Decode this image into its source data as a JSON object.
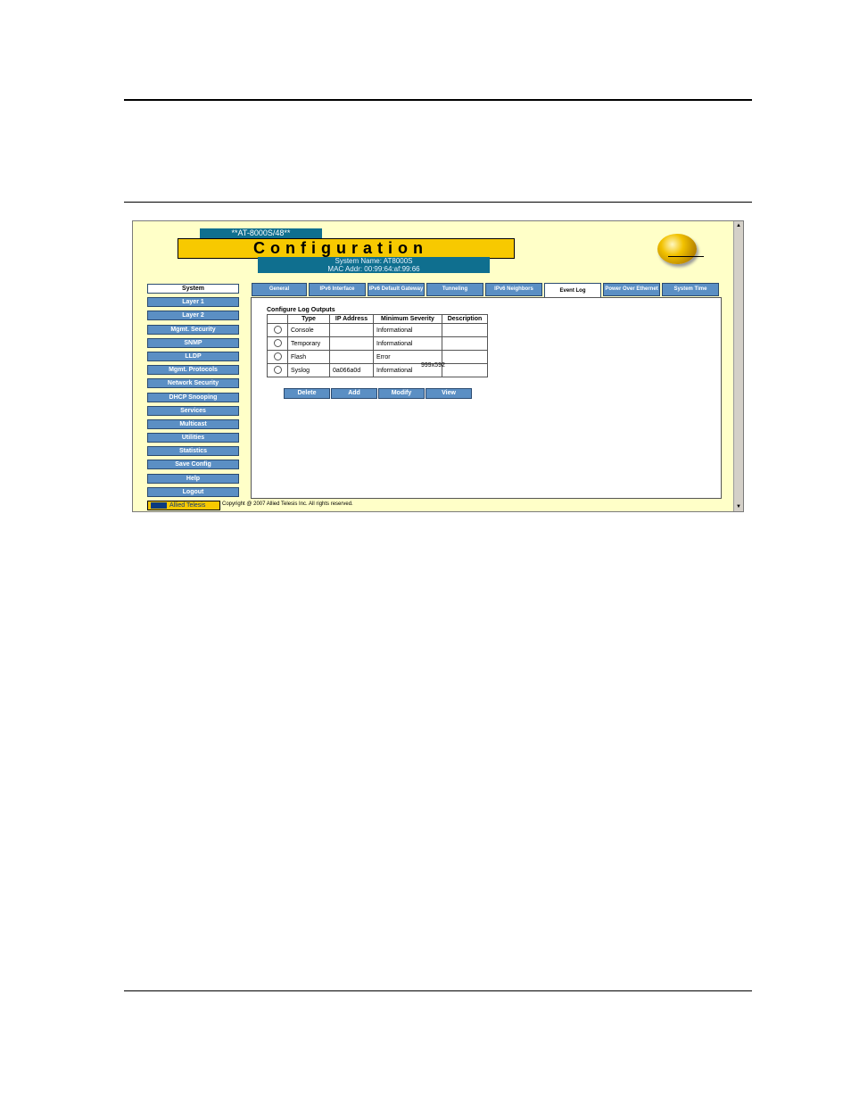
{
  "banner": {
    "device_name": "**AT-8000S/48**",
    "title": "Configuration",
    "system_name": "System Name: AT8000S",
    "mac_addr": "MAC Addr: 00:99:64:af:99:66"
  },
  "nav": {
    "items": [
      {
        "label": "System",
        "active": true
      },
      {
        "label": "Layer 1"
      },
      {
        "label": "Layer 2"
      },
      {
        "label": "Mgmt. Security"
      },
      {
        "label": "SNMP"
      },
      {
        "label": "LLDP"
      },
      {
        "label": "Mgmt. Protocols"
      },
      {
        "label": "Network Security"
      },
      {
        "label": "DHCP Snooping"
      },
      {
        "label": "Services"
      },
      {
        "label": "Multicast"
      },
      {
        "label": "Utilities"
      },
      {
        "label": "Statistics"
      },
      {
        "label": "Save Config"
      },
      {
        "label": "Help"
      },
      {
        "label": "Logout"
      }
    ]
  },
  "tabs": {
    "general": "General",
    "ipv6_interface": "IPv6 Interface",
    "ipv6_default_gateway": "IPv6 Default Gateway",
    "tunneling": "Tunneling",
    "ipv6_neighbors": "IPv6 Neighbors",
    "event_log": "Event Log",
    "power_over_ethernet": "Power Over Ethernet",
    "system_time": "System Time"
  },
  "panel": {
    "section_title": "Configure Log Outputs",
    "headers": {
      "type": "Type",
      "ip": "IP Address",
      "severity": "Minimum Severity",
      "description": "Description"
    },
    "rows": [
      {
        "type": "Console",
        "ip": "",
        "severity": "Informational",
        "description": ""
      },
      {
        "type": "Temporary",
        "ip": "",
        "severity": "Informational",
        "description": ""
      },
      {
        "type": "Flash",
        "ip": "",
        "severity": "Error",
        "description": ""
      },
      {
        "type": "Syslog",
        "ip": "0a066a0d",
        "severity": "Informational",
        "description": ""
      }
    ],
    "overlay_label": "999x592",
    "buttons": {
      "delete": "Delete",
      "add": "Add",
      "modify": "Modify",
      "view": "View"
    }
  },
  "footer": {
    "logo_text": "Allied Telesis",
    "copyright": "Copyright @ 2007 Allied Telesis Inc. All rights reserved."
  }
}
